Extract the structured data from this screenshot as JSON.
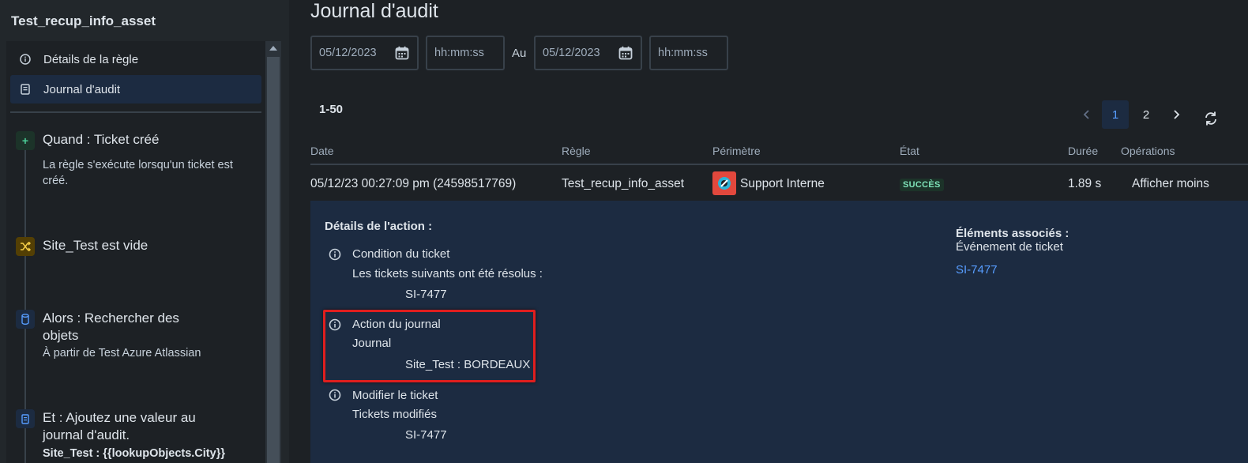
{
  "sidebar": {
    "title": "Test_recup_info_asset",
    "nav": [
      {
        "label": "Détails de la règle",
        "icon": "info-icon",
        "active": false
      },
      {
        "label": "Journal d'audit",
        "icon": "document-icon",
        "active": true
      }
    ],
    "steps": [
      {
        "icon": "plus-icon",
        "title": "Quand : Ticket créé",
        "desc": "La règle s'exécute lorsqu'un ticket est créé.",
        "color": "#4bce97"
      },
      {
        "icon": "shuffle-icon",
        "title": "Site_Test est vide",
        "desc": "",
        "color": "#f5cd47"
      },
      {
        "icon": "database-icon",
        "title": "Alors : Rechercher des objets",
        "desc": "À partir de Test Azure Atlassian",
        "color": "#579dff"
      },
      {
        "icon": "document-icon",
        "title": "Et : Ajoutez une valeur au journal d'audit.",
        "desc": "Site_Test : {{lookupObjects.City}}",
        "color": "#579dff"
      }
    ]
  },
  "main": {
    "title": "Journal d'audit",
    "filters": {
      "from_date": "05/12/2023",
      "from_time_placeholder": "hh:mm:ss",
      "separator": "Au",
      "to_date": "05/12/2023",
      "to_time_placeholder": "hh:mm:ss"
    },
    "range_label": "1-50",
    "pagination": {
      "pages": [
        "1",
        "2"
      ],
      "current": "1"
    },
    "table": {
      "columns": [
        "Date",
        "Règle",
        "Périmètre",
        "État",
        "Durée",
        "Opérations"
      ],
      "row": {
        "date": "05/12/23 00:27:09 pm (24598517769)",
        "rule": "Test_recup_info_asset",
        "scope": "Support Interne",
        "status": "SUCCÈS",
        "duration": "1.89 s",
        "operation": "Afficher moins"
      }
    },
    "details": {
      "heading": "Détails de l'action :",
      "items": [
        {
          "title": "Condition du ticket",
          "sub": "Les tickets suivants ont été résolus :",
          "value": "SI-7477"
        },
        {
          "title": "Action du journal",
          "sub": "Journal",
          "value": "Site_Test : BORDEAUX"
        },
        {
          "title": "Modifier le ticket",
          "sub": "Tickets modifiés",
          "value": "SI-7477"
        }
      ],
      "associated_heading": "Éléments associés :",
      "associated_type": "Événement de ticket",
      "associated_link": "SI-7477"
    },
    "colors": {
      "accent": "#579dff",
      "highlight": "#e01e1e",
      "success": "#7ee2b8"
    }
  }
}
